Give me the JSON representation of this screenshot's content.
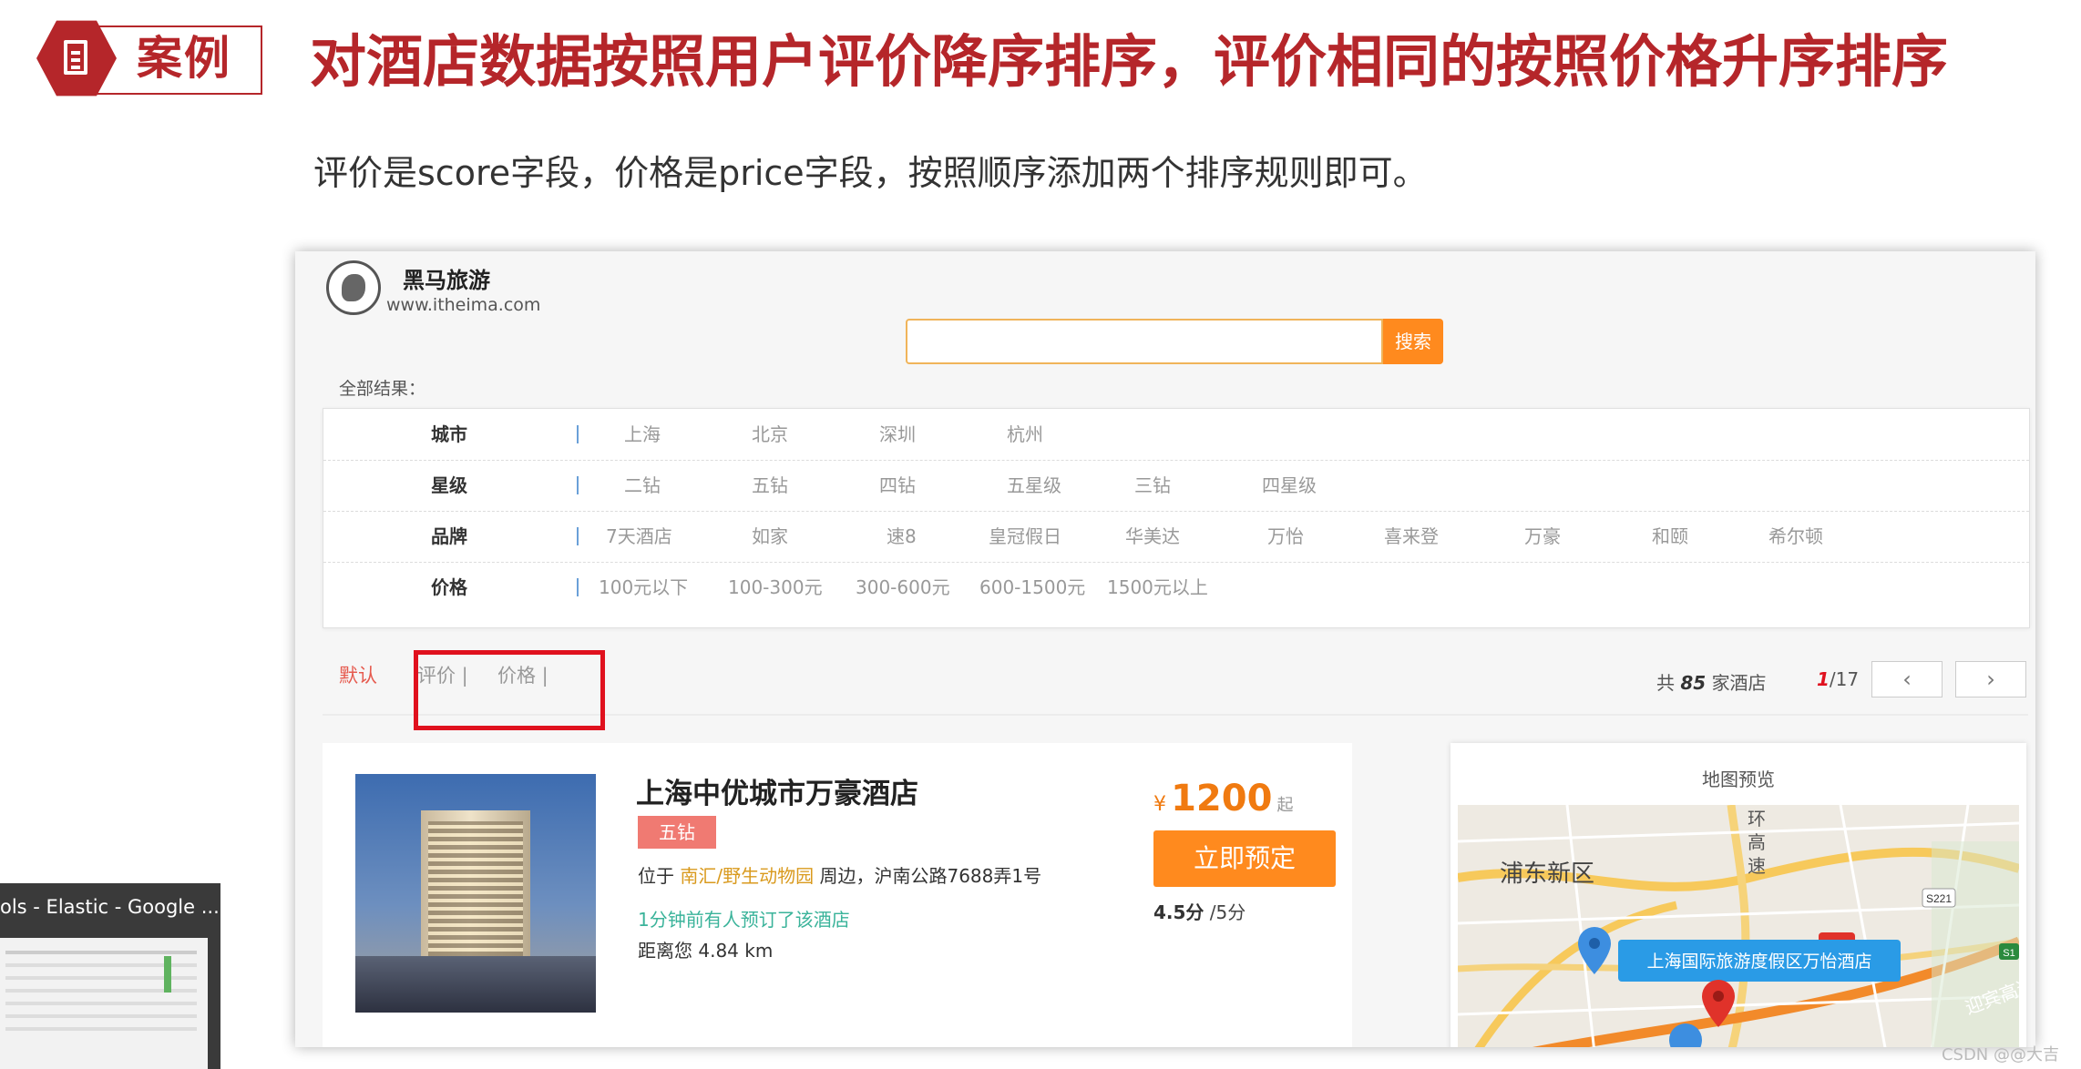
{
  "slide": {
    "badge": "案例",
    "title": "对酒店数据按照用户评价降序排序，评价相同的按照价格升序排序",
    "subtitle": "评价是score字段，价格是price字段，按照顺序添加两个排序规则即可。"
  },
  "site": {
    "name": "黑马旅游",
    "url": "www.itheima.com",
    "search_button": "搜索",
    "all_results": "全部结果："
  },
  "filters": [
    {
      "label": "城市",
      "options": [
        "上海",
        "北京",
        "深圳",
        "杭州"
      ]
    },
    {
      "label": "星级",
      "options": [
        "二钻",
        "五钻",
        "四钻",
        "五星级",
        "三钻",
        "四星级"
      ]
    },
    {
      "label": "品牌",
      "options": [
        "7天酒店",
        "如家",
        "速8",
        "皇冠假日",
        "华美达",
        "万怡",
        "喜来登",
        "万豪",
        "和颐",
        "希尔顿"
      ]
    },
    {
      "label": "价格",
      "options": [
        "100元以下",
        "100-300元",
        "300-600元",
        "600-1500元",
        "1500元以上"
      ]
    }
  ],
  "sort": {
    "default": "默认",
    "score": "评价 |",
    "price": "价格 |",
    "total_prefix": "共",
    "total_count": "85",
    "total_suffix": "家酒店",
    "current_page": "1",
    "total_pages": "/17",
    "prev": "‹",
    "next": "›"
  },
  "hotel": {
    "name": "上海中优城市万豪酒店",
    "star": "五钻",
    "addr_prefix": "位于",
    "addr_area": "南汇/野生动物园",
    "addr_suffix": "周边，沪南公路7688弄1号",
    "recent": "1分钟前有人预订了该酒店",
    "distance": "距离您 4.84 km",
    "currency": "¥",
    "price": "1200",
    "price_suffix": "起",
    "book": "立即预定",
    "score": "4.5分",
    "score_max": "/5分"
  },
  "map": {
    "title": "地图预览",
    "district": "浦东新区",
    "road1": "环",
    "road2": "高",
    "road3": "速",
    "hotel_label": "上海国际旅游度假区万怡酒店",
    "road_sign": "S221",
    "road_sign2": "S1",
    "highway": "迎宾高速",
    "colors": {
      "road": "#f7b92b",
      "marker_blue": "#3d8ee0",
      "marker_red": "#e0322a",
      "label_bg": "#2a9be6"
    }
  },
  "taskbar": {
    "window_title": "ols - Elastic - Google ..."
  },
  "watermark": "CSDN @@大吉"
}
